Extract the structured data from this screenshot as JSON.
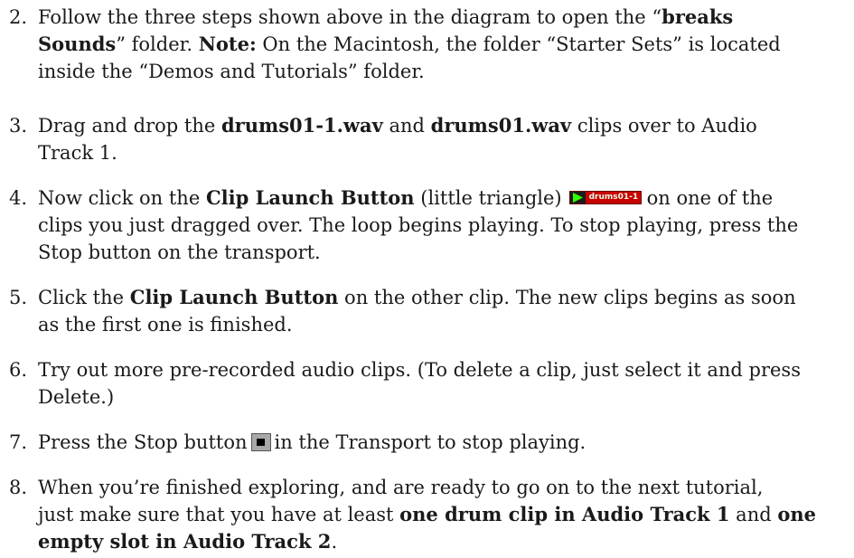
{
  "steps": [
    {
      "number": "2.",
      "lines": [
        {
          "p1": "Follow the three steps shown above in the diagram to open the “",
          "b1": "breaks",
          "p2": ""
        },
        {
          "b1": "Sounds",
          "p1": "” folder. ",
          "b2": "Note:",
          "p2": " On the Macintosh, the folder “Starter Sets” is located"
        },
        {
          "p1": "inside the “Demos and Tutorials” folder."
        }
      ]
    },
    {
      "number": "3.",
      "lines": [
        {
          "p1": "Drag and drop the ",
          "b1": "drums01-1.wav",
          "p2": " and ",
          "b2": "drums01.wav",
          "p3": " clips over to Audio"
        },
        {
          "p1": "Track 1."
        }
      ]
    },
    {
      "number": "4.",
      "lines": [
        {
          "p1": "Now click on the ",
          "b1": "Clip Launch Button",
          "p2": " (little triangle)",
          "p3": "on one of the"
        },
        {
          "p1": "clips you just dragged over. The loop begins playing. To stop playing, press the"
        },
        {
          "p1": "Stop button on the transport."
        }
      ]
    },
    {
      "number": "5.",
      "lines": [
        {
          "p1": "Click the ",
          "b1": "Clip Launch Button",
          "p2": " on the other clip. The new clips begins as soon"
        },
        {
          "p1": "as the first one is finished."
        }
      ]
    },
    {
      "number": "6.",
      "lines": [
        {
          "p1": "Try out more pre-recorded audio clips. (To delete a clip, just select it and press"
        },
        {
          "p1": "Delete.)"
        }
      ]
    },
    {
      "number": "7.",
      "lines": [
        {
          "p1": "Press the Stop button",
          "p2": "in the Transport to stop playing."
        }
      ]
    },
    {
      "number": "8.",
      "lines": [
        {
          "p1": "When you’re finished exploring, and are ready to go on to the next tutorial,"
        },
        {
          "p1": "just make sure that you have at least ",
          "b1": "one drum clip in Audio Track 1",
          "p2": " and ",
          "b2": "one"
        },
        {
          "b1": "empty slot in Audio Track 2",
          "p1": "."
        }
      ]
    }
  ],
  "icons": {
    "clip_launch": {
      "name": "clip-launch-button-icon",
      "label": "drums01-1",
      "body_color": "#c80000",
      "triangle_color": "#33ff00"
    },
    "stop": {
      "name": "stop-button-icon",
      "square_color": "#000000",
      "body_color": "#a8a8a8"
    }
  }
}
